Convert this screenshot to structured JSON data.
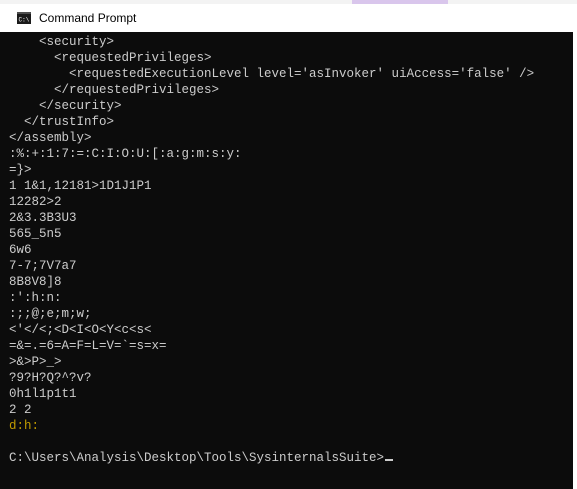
{
  "window": {
    "title": "Command Prompt",
    "icon": "cmd-icon"
  },
  "colors": {
    "console_bg": "#0c0c0c",
    "console_text": "#cccccc",
    "yellow_text": "#c19c00"
  },
  "console": {
    "lines": [
      "    <security>",
      "      <requestedPrivileges>",
      "        <requestedExecutionLevel level='asInvoker' uiAccess='false' />",
      "      </requestedPrivileges>",
      "    </security>",
      "  </trustInfo>",
      "</assembly>",
      ":%:+:1:7:=:C:I:O:U:[:a:g:m:s:y:",
      "=}>",
      "1 1&1,12181>1D1J1P1",
      "12282>2",
      "2&3.3B3U3",
      "565_5n5",
      "6w6",
      "7-7;7V7a7",
      "8B8V8]8",
      ":':h:n:",
      ":;;@;e;m;w;",
      "<'</<;<D<I<O<Y<c<s<",
      "=&=.=6=A=F=L=V=`=s=x=",
      ">&>P>_>",
      "?9?H?Q?^?v?",
      "0h1l1p1t1",
      "2 2",
      "d:h:",
      "",
      "C:\\Users\\Analysis\\Desktop\\Tools\\SysinternalsSuite>"
    ]
  }
}
